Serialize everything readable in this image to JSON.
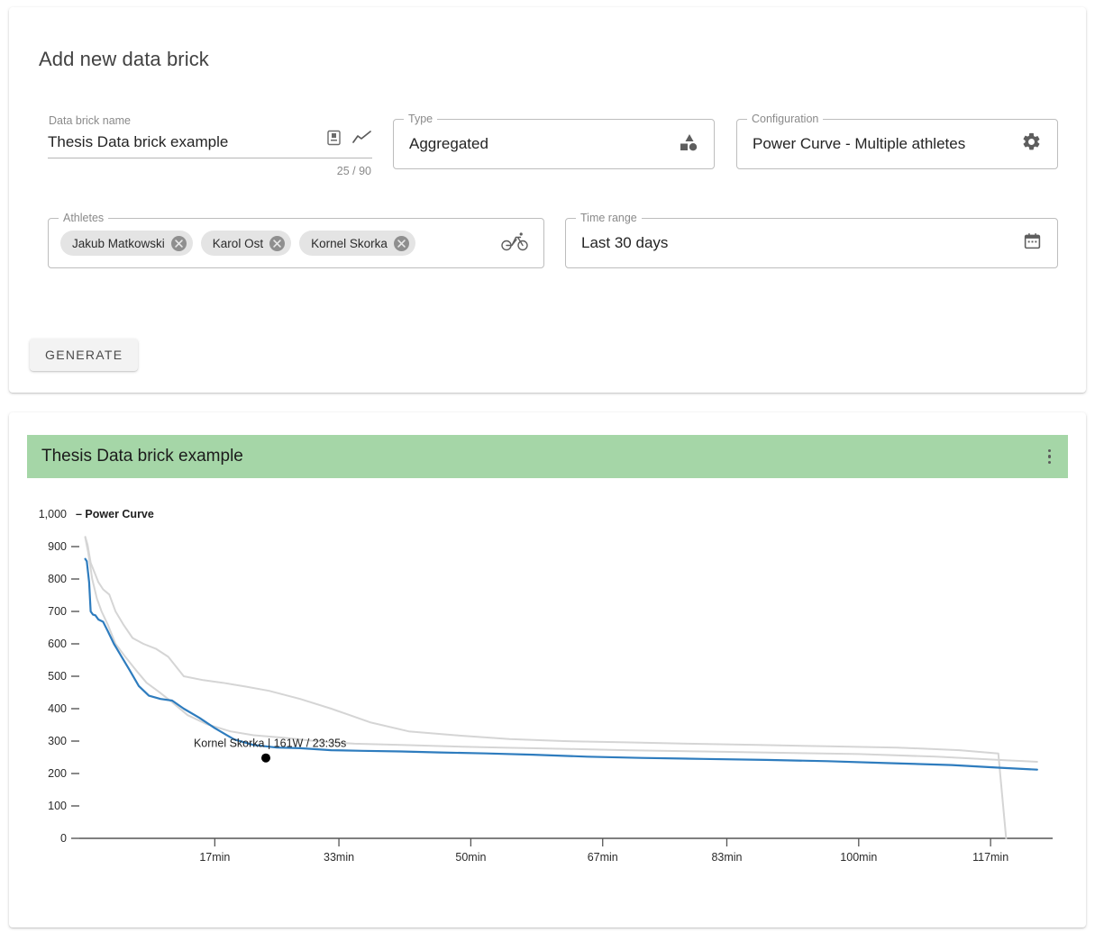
{
  "form": {
    "title": "Add new data brick",
    "name_field": {
      "label": "Data brick name",
      "value": "Thesis Data brick example",
      "counter": "25 / 90",
      "save_icon": "save-icon",
      "trend_icon": "line-chart-icon"
    },
    "type_field": {
      "label": "Type",
      "value": "Aggregated",
      "icon": "shapes-icon"
    },
    "configuration_field": {
      "label": "Configuration",
      "value": "Power Curve - Multiple athletes",
      "icon": "gear-icon"
    },
    "athletes_field": {
      "label": "Athletes",
      "icon": "bicycle-icon",
      "chips": [
        {
          "label": "Jakub Matkowski",
          "remove_icon": "close-circle-icon"
        },
        {
          "label": "Karol Ost",
          "remove_icon": "close-circle-icon"
        },
        {
          "label": "Kornel Skorka",
          "remove_icon": "close-circle-icon"
        }
      ]
    },
    "time_range_field": {
      "label": "Time range",
      "value": "Last 30 days",
      "icon": "calendar-icon"
    },
    "generate_button": "GENERATE"
  },
  "chart_card": {
    "header_title": "Thesis Data brick example",
    "header_color": "#a5d6a7",
    "menu_icon": "kebab-menu-icon"
  },
  "chart_data": {
    "type": "line",
    "title": "Power Curve",
    "xlabel": "",
    "ylabel": "Power Curve",
    "ylim": [
      0,
      1000
    ],
    "ytick_labels": [
      "0",
      "100",
      "200",
      "300",
      "400",
      "500",
      "600",
      "700",
      "800",
      "900",
      "1,000"
    ],
    "ytick_values": [
      0,
      100,
      200,
      300,
      400,
      500,
      600,
      700,
      800,
      900,
      1000
    ],
    "xtick_labels": [
      "17min",
      "33min",
      "50min",
      "67min",
      "83min",
      "100min",
      "117min"
    ],
    "xtick_values": [
      17,
      33,
      50,
      67,
      83,
      100,
      117
    ],
    "xlim": [
      0,
      125
    ],
    "grid": false,
    "legend_position": "none",
    "annotation": {
      "text": "Kornel Skorka | 161W / 23:35s",
      "x": 23.58,
      "y": 248,
      "marker_color": "#000000"
    },
    "series": [
      {
        "name": "Kornel Skorka",
        "color": "#2e7cbe",
        "highlighted": true,
        "x": [
          0.3,
          0.5,
          0.8,
          1.0,
          1.3,
          1.6,
          2.0,
          2.6,
          3.2,
          4.0,
          5.0,
          6.0,
          7.2,
          8.5,
          10.0,
          11.5,
          13.0,
          15.0,
          17.0,
          19.5,
          22.0,
          25.0,
          28.0,
          32.0,
          36.0,
          41.0,
          46.0,
          52.0,
          58.0,
          65.0,
          72.0,
          80.0,
          88.0,
          96.0,
          104.0,
          112.0,
          118.0,
          123.0
        ],
        "y": [
          862,
          855,
          790,
          700,
          690,
          688,
          675,
          668,
          640,
          600,
          560,
          520,
          470,
          440,
          430,
          425,
          400,
          372,
          340,
          305,
          288,
          280,
          278,
          272,
          270,
          268,
          265,
          262,
          258,
          252,
          248,
          245,
          242,
          238,
          232,
          226,
          218,
          212
        ]
      },
      {
        "name": "athlete-2",
        "color": "#d5d5d5",
        "highlighted": false,
        "x": [
          0.3,
          0.6,
          1.0,
          1.5,
          2.0,
          2.6,
          3.4,
          4.2,
          5.2,
          6.4,
          7.8,
          9.4,
          11.0,
          13.0,
          15.5,
          18.0,
          21.0,
          24.0,
          28.0,
          32.0,
          37.0,
          42.0,
          48.0,
          55.0,
          62.0,
          70.0,
          78.0,
          87.0,
          96.0,
          105.0,
          113.0,
          118.0,
          119.0
        ],
        "y": [
          930,
          905,
          850,
          820,
          790,
          768,
          752,
          700,
          660,
          618,
          600,
          585,
          560,
          500,
          488,
          480,
          468,
          455,
          430,
          400,
          358,
          330,
          318,
          306,
          300,
          296,
          292,
          288,
          284,
          280,
          272,
          262,
          0
        ]
      },
      {
        "name": "athlete-3",
        "color": "#d5d5d5",
        "highlighted": false,
        "x": [
          0.3,
          0.7,
          1.2,
          1.8,
          2.4,
          3.2,
          4.2,
          5.4,
          6.8,
          8.2,
          9.8,
          11.5,
          13.5,
          16.0,
          19.0,
          22.0,
          26.0,
          30.0,
          35.0,
          41.0,
          47.0,
          54.0,
          62.0,
          70.0,
          80.0,
          90.0,
          100.0,
          110.0,
          118.0,
          123.0
        ],
        "y": [
          928,
          880,
          800,
          740,
          700,
          660,
          600,
          562,
          520,
          480,
          452,
          420,
          380,
          352,
          330,
          318,
          310,
          300,
          292,
          288,
          284,
          280,
          276,
          272,
          268,
          264,
          260,
          252,
          242,
          236
        ]
      }
    ]
  }
}
